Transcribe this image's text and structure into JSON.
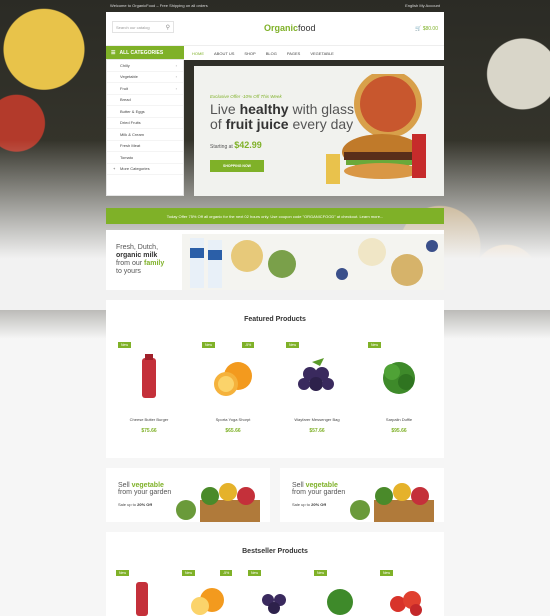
{
  "topbar": {
    "left": "Welcome to OrganicFood – Free Shipping on all orders",
    "right": "English    My Account"
  },
  "header": {
    "search_placeholder": "Search our catalog",
    "logo_main": "Organic",
    "logo_sub": "food",
    "cart": "$80.00"
  },
  "nav": {
    "all_categories": "ALL CATEGORIES",
    "items": [
      "HOME",
      "ABOUT US",
      "SHOP",
      "BLOG",
      "PAGES",
      "VEGETABLE"
    ]
  },
  "categories": [
    "Chilly",
    "Vegetable",
    "Fruit",
    "Bread",
    "Butter & Eggs",
    "Dried Fruits",
    "Milk & Cream",
    "Fresh Meat",
    "Tomato",
    "More Categories"
  ],
  "hero": {
    "offer": "Exclusive Offer -10% Off This Week",
    "line1a": "Live ",
    "line1b": "healthy",
    "line1c": " with glass",
    "line2a": "of ",
    "line2b": "fruit juice",
    "line2c": " every day",
    "starting": "Starting at",
    "price": "$42.99",
    "button": "SHOPPING NOW"
  },
  "promo": {
    "text": "Today Offer 75% Off all organic for the next 02 hours only. Use coupon code \"ORGANICFOOD\" at checkout. Learn more..."
  },
  "milk_banner": {
    "l1": "Fresh, Dutch,",
    "l2": "organic milk",
    "l3a": "from our ",
    "l3b": "family",
    "l4": "to yours"
  },
  "featured": {
    "title": "Featured Products",
    "products": [
      {
        "badge": "New",
        "name": "Cheese Butter Burger",
        "price": "$75.66",
        "badge2": ""
      },
      {
        "badge": "New",
        "name": "Sporta Yoga Shorpt",
        "price": "$65.66",
        "badge2": "-5%"
      },
      {
        "badge": "New",
        "name": "Wayfarer Messenger Bag",
        "price": "$57.66",
        "badge2": ""
      },
      {
        "badge": "New",
        "name": "Sarpalin Duffle",
        "price": "$95.66",
        "badge2": ""
      }
    ]
  },
  "sell_banners": [
    {
      "l1a": "Sell ",
      "l1b": "vegetable",
      "l2": "from your garden",
      "sale": "Sale up to ",
      "pct": "20% Off"
    },
    {
      "l1a": "Sell ",
      "l1b": "vegetable",
      "l2": "from your garden",
      "sale": "Sale up to ",
      "pct": "20% Off"
    }
  ],
  "bestseller": {
    "title": "Bestseller Products",
    "products": [
      {
        "badge": "New",
        "badge2": ""
      },
      {
        "badge": "New",
        "badge2": "-5%"
      },
      {
        "badge": "New",
        "badge2": ""
      },
      {
        "badge": "New",
        "badge2": ""
      },
      {
        "badge": "New",
        "badge2": ""
      }
    ]
  },
  "colors": {
    "accent": "#7fb128",
    "text": "#333333"
  }
}
